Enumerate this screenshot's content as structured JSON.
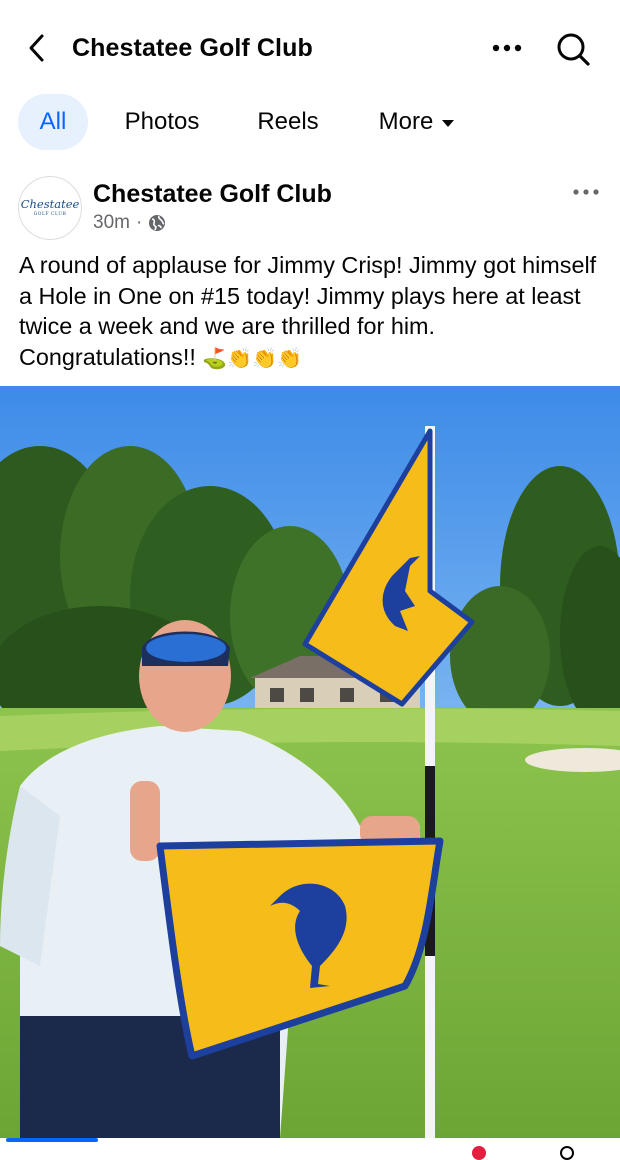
{
  "header": {
    "title": "Chestatee Golf Club",
    "back_icon": "chevron-left-icon",
    "more_icon": "more-horizontal-icon",
    "search_icon": "search-icon"
  },
  "tabs": [
    {
      "label": "All",
      "active": true
    },
    {
      "label": "Photos",
      "active": false
    },
    {
      "label": "Reels",
      "active": false
    },
    {
      "label": "More",
      "active": false,
      "icon": "caret-down-icon"
    }
  ],
  "post": {
    "author": "Chestatee Golf Club",
    "avatar_text": "Chestatee",
    "avatar_subtext": "GOLF CLUB",
    "time": "30m",
    "separator": "·",
    "privacy_icon": "globe-icon",
    "options_icon": "more-horizontal-icon",
    "text": "A round of applause for Jimmy Crisp!  Jimmy got himself a Hole in One on #15 today!  Jimmy plays here at least twice a week and we are thrilled for him.  Congratulations!!",
    "emojis": "⛳👏👏👏",
    "photo_alt_icon": "photo-icon"
  },
  "colors": {
    "accent": "#0866ff",
    "active_tab_bg": "#e7f0fd",
    "secondary_text": "#65676b",
    "flag_yellow": "#f6bd1a",
    "flag_blue": "#1d3f9e"
  }
}
